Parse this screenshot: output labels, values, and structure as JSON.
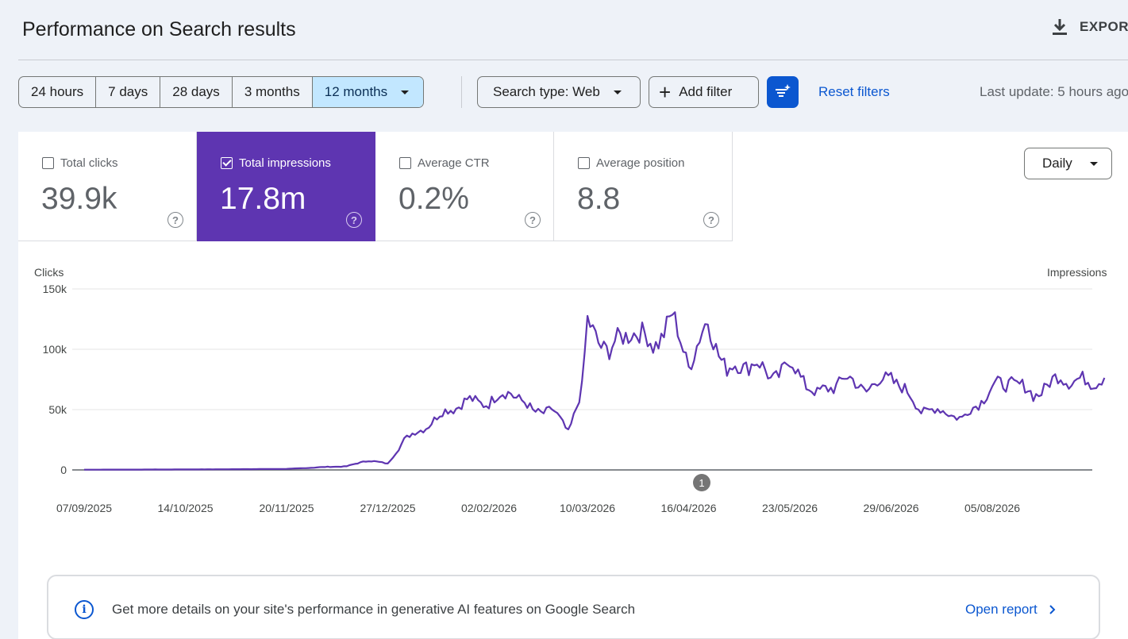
{
  "header": {
    "title": "Performance on Search results",
    "export_label": "EXPORT"
  },
  "date_range": {
    "options": [
      "24 hours",
      "7 days",
      "28 days",
      "3 months",
      "12 months"
    ],
    "selected": "12 months"
  },
  "filters": {
    "search_type": "Search type: Web",
    "add_filter": "Add filter",
    "reset": "Reset filters",
    "last_update": "Last update: 5 hours ago"
  },
  "metrics": [
    {
      "label": "Total clicks",
      "value": "39.9k",
      "checked": false
    },
    {
      "label": "Total impressions",
      "value": "17.8m",
      "checked": true
    },
    {
      "label": "Average CTR",
      "value": "0.2%",
      "checked": false
    },
    {
      "label": "Average position",
      "value": "8.8",
      "checked": false
    }
  ],
  "granularity": "Daily",
  "chart": {
    "left_axis_title": "Clicks",
    "right_axis_title": "Impressions",
    "annotation_marker": "1"
  },
  "chart_data": {
    "type": "line",
    "series": [
      {
        "name": "Total impressions",
        "color": "#5e35b1",
        "points": [
          [
            "07/09/2025",
            200
          ],
          [
            "14/10/2025",
            400
          ],
          [
            "20/11/2025",
            800
          ],
          [
            "05/12/2025",
            2500
          ],
          [
            "12/12/2025",
            3000
          ],
          [
            "20/12/2025",
            8000
          ],
          [
            "27/12/2025",
            5000
          ],
          [
            "02/01/2026",
            25000
          ],
          [
            "10/01/2026",
            36000
          ],
          [
            "18/01/2026",
            50000
          ],
          [
            "25/01/2026",
            57000
          ],
          [
            "02/02/2026",
            56000
          ],
          [
            "10/02/2026",
            66000
          ],
          [
            "18/02/2026",
            48000
          ],
          [
            "25/02/2026",
            50000
          ],
          [
            "03/03/2026",
            32000
          ],
          [
            "08/03/2026",
            67000
          ],
          [
            "10/03/2026",
            120000
          ],
          [
            "18/03/2026",
            98000
          ],
          [
            "26/03/2026",
            118000
          ],
          [
            "03/04/2026",
            103000
          ],
          [
            "10/04/2026",
            126000
          ],
          [
            "16/04/2026",
            88000
          ],
          [
            "23/04/2026",
            121000
          ],
          [
            "30/04/2026",
            82000
          ],
          [
            "10/05/2026",
            90000
          ],
          [
            "16/05/2026",
            76000
          ],
          [
            "23/05/2026",
            88000
          ],
          [
            "02/06/2026",
            62000
          ],
          [
            "12/06/2026",
            76000
          ],
          [
            "20/06/2026",
            67000
          ],
          [
            "29/06/2026",
            78000
          ],
          [
            "10/07/2026",
            50000
          ],
          [
            "20/07/2026",
            48000
          ],
          [
            "25/07/2026",
            42000
          ],
          [
            "05/08/2026",
            68000
          ],
          [
            "12/08/2026",
            74000
          ],
          [
            "20/08/2026",
            62000
          ],
          [
            "30/08/2026",
            77000
          ],
          [
            "10/09/2026",
            72000
          ],
          [
            "15/09/2026",
            79000
          ]
        ]
      }
    ],
    "x_tick_labels": [
      "07/09/2025",
      "14/10/2025",
      "20/11/2025",
      "27/12/2025",
      "02/02/2026",
      "10/03/2026",
      "16/04/2026",
      "23/05/2026",
      "29/06/2026",
      "05/08/2026"
    ],
    "y_tick_labels": [
      "150k",
      "100k",
      "50k",
      "0"
    ],
    "ylim": [
      0,
      150000
    ],
    "grid": true,
    "xlabel": "",
    "ylabel": "Clicks"
  },
  "banner": {
    "text": "Get more details on your site's performance in generative AI features on Google Search",
    "link": "Open report"
  }
}
